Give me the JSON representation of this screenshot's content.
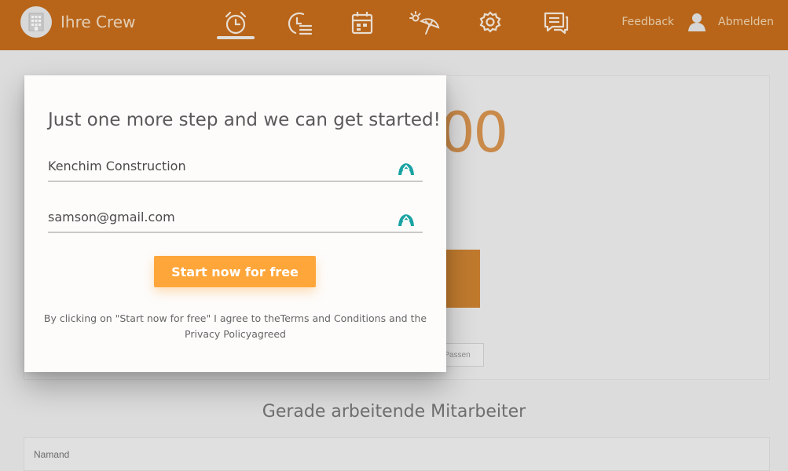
{
  "header": {
    "app_name": "Ihre Crew",
    "feedback_label": "Feedback",
    "logout_label": "Abmelden",
    "accent_color": "#b8651a",
    "nav_icons": [
      "alarm-clock-icon",
      "history-clock-icon",
      "calendar-icon",
      "vacation-umbrella-icon",
      "gear-icon",
      "chat-icon"
    ]
  },
  "background": {
    "big_number": "00",
    "small_button_label": "Passen",
    "section_title": "Gerade arbeitende Mitarbeiter",
    "table_header_name": "Namand"
  },
  "modal": {
    "title": "Just one more step and we can get started!",
    "company_value": "Kenchim Construction",
    "email_value": "samson@gmail.com",
    "cta_label": "Start now for free",
    "cta_color": "#ffa63a",
    "legal_line1": "By clicking on \"Start now for free\" I agree to theTerms and Conditions and the",
    "legal_line2": "Privacy Policyagreed"
  }
}
